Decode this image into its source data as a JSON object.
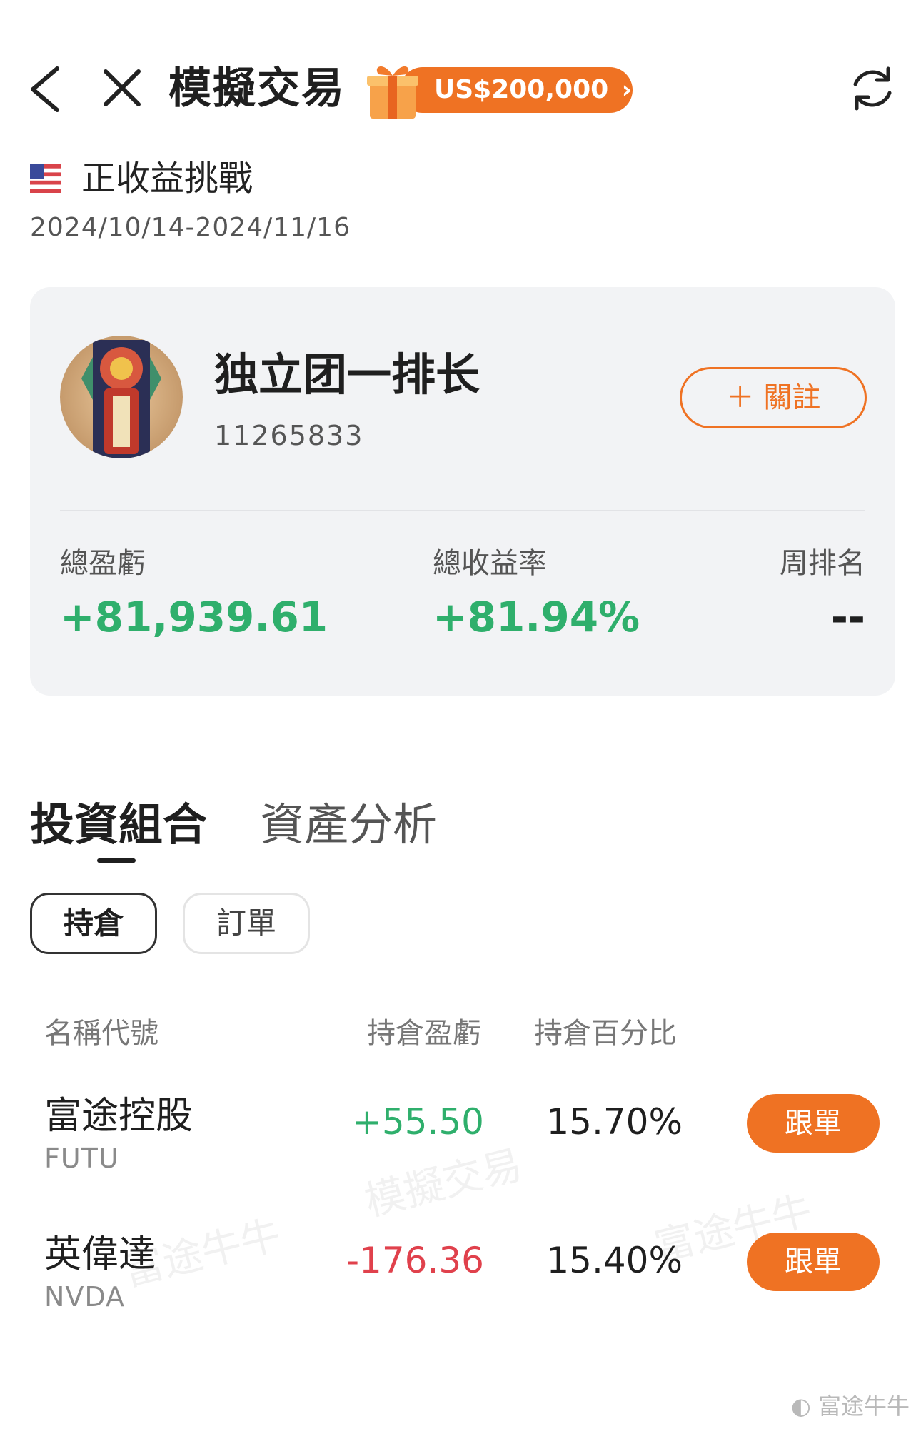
{
  "header": {
    "title": "模擬交易",
    "promo_amount": "US$200,000"
  },
  "challenge": {
    "title": "正收益挑戰",
    "dates": "2024/10/14-2024/11/16"
  },
  "profile": {
    "username": "独立团一排长",
    "user_id": "11265833",
    "follow_label": "＋ 關註"
  },
  "stats": {
    "total_pnl_label": "總盈虧",
    "total_pnl_value": "+81,939.61",
    "total_return_label": "總收益率",
    "total_return_value": "+81.94%",
    "weekly_rank_label": "周排名",
    "weekly_rank_value": "--"
  },
  "tabs": [
    {
      "label": "投資組合",
      "active": true
    },
    {
      "label": "資產分析",
      "active": false
    }
  ],
  "subtabs": [
    {
      "label": "持倉",
      "active": true
    },
    {
      "label": "訂單",
      "active": false
    }
  ],
  "table": {
    "headers": [
      "名稱代號",
      "持倉盈虧",
      "持倉百分比"
    ],
    "rows": [
      {
        "name": "富途控股",
        "code": "FUTU",
        "pnl": "+55.50",
        "pct": "15.70%",
        "action": "跟單"
      },
      {
        "name": "英偉達",
        "code": "NVDA",
        "pnl": "-176.36",
        "pct": "15.40%",
        "action": "跟單"
      }
    ]
  },
  "watermarks": {
    "sim": "模擬交易",
    "brand": "富途牛牛",
    "corner": "富途牛牛"
  },
  "colors": {
    "accent": "#ef7223",
    "positive": "#2faf6c",
    "negative": "#e0414c"
  }
}
